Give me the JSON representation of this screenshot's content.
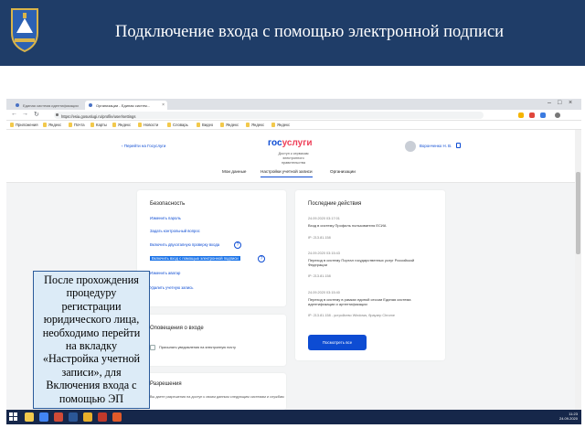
{
  "slide": {
    "title": "Подключение входа с помощью электронной подписи",
    "callout": "После прохождения процедуру регистрации юридического лица, необходимо перейти на вкладку «Настройка учетной записи», для Включения входа с помощью ЭП"
  },
  "browser": {
    "tabs": [
      {
        "label": "Единая система идентификации"
      },
      {
        "label": "Организации - Единая систем..."
      }
    ],
    "url": "https://esia.gosuslugi.ru/profile/user/settings",
    "bookmarks": [
      "Приложения",
      "Яндекс",
      "Почта",
      "Карты",
      "Яндекс",
      "Новости",
      "Словарь",
      "Видео",
      "Яндекс",
      "Яндекс",
      "Яндекс"
    ]
  },
  "site": {
    "back_link": "‹ Перейти на Госуслуги",
    "logo_part1": "гос",
    "logo_part2": "услуги",
    "logo_subtitle": "Доступ к сервисам электронного правительства",
    "user_name": "Воронченко Н. В.",
    "tabs": [
      "Мои данные",
      "Настройки учетной записи",
      "Организации"
    ]
  },
  "security": {
    "title": "Безопасность",
    "links": [
      "Изменить пароль",
      "Задать контрольный вопрос",
      "Включить двухэтапную проверку входа",
      "Включить вход с помощью электронной подписи",
      "Изменить аватар",
      "Удалить учетную запись"
    ],
    "help_glyph": "?"
  },
  "actions": {
    "title": "Последние действия",
    "items": [
      {
        "date": "24.09.2020 03:17:01",
        "text": "Вход в систему Профиль пользователя ЕСИА",
        "ip": "IP: 213.81.158"
      },
      {
        "date": "24.09.2020 03:15:43",
        "text": "Переход в систему Портал государственных услуг Российской Федерации",
        "ip": "IP: 213.81.158"
      },
      {
        "date": "24.09.2020 03:15:40",
        "text": "Переход в систему в рамках единой сессии Единая система идентификации и аутентификации",
        "ip": "IP: 213.81.158 - устройство Windows, браузер Chrome"
      }
    ],
    "button": "Посмотреть все"
  },
  "notifications": {
    "title": "Оповещения о входе",
    "checkbox_label": "Присылать уведомления на электронную почту"
  },
  "permissions": {
    "title": "Разрешения",
    "text": "Вы даете разрешения на доступ к своим данным следующим системам и службам"
  },
  "clock": {
    "time": "11:23",
    "date": "24.09.2020"
  },
  "colors": {
    "slide_header": "#1f3d68",
    "accent": "#0d4cd3",
    "logo_red": "#ee3f58",
    "callout_bg": "#dcebf7"
  }
}
